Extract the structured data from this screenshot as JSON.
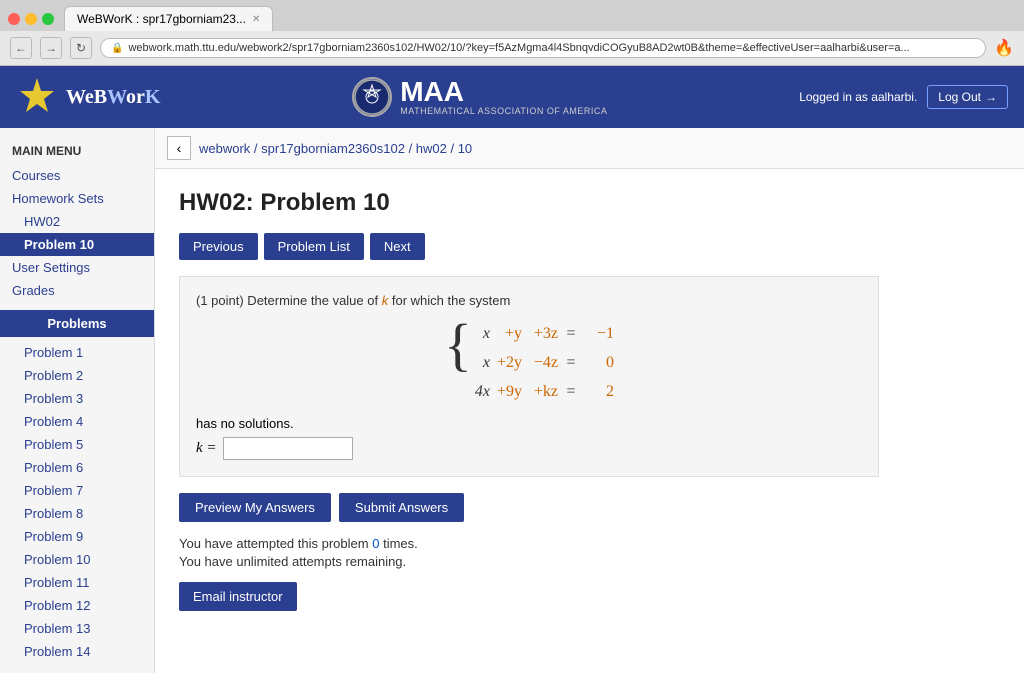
{
  "browser": {
    "tab_title": "WeBWorK : spr17gborniam23...",
    "url": "webwork.math.ttu.edu/webwork2/spr17gborniam2360s102/HW02/10/?key=f5AzMgma4l4SbnqvdiCOGyuB8AD2wt0B&theme=&effectiveUser=aalharbi&user=a...",
    "back_label": "←",
    "forward_label": "→",
    "refresh_label": "↻"
  },
  "header": {
    "logo_text": "WeBWorK",
    "maa_big": "MAA",
    "maa_sub": "MATHEMATICAL ASSOCIATION OF AMERICA",
    "logged_in_label": "Logged in as",
    "logged_in_user": "aalharbi.",
    "logout_label": "Log Out"
  },
  "sidebar": {
    "main_menu_title": "MAIN MENU",
    "links": [
      {
        "label": "Courses",
        "id": "courses",
        "indented": false,
        "active": false
      },
      {
        "label": "Homework Sets",
        "id": "homework-sets",
        "indented": false,
        "active": false
      },
      {
        "label": "HW02",
        "id": "hw02",
        "indented": true,
        "active": false
      },
      {
        "label": "Problem 10",
        "id": "problem-10",
        "indented": true,
        "active": true
      },
      {
        "label": "User Settings",
        "id": "user-settings",
        "indented": false,
        "active": false
      },
      {
        "label": "Grades",
        "id": "grades",
        "indented": false,
        "active": false
      }
    ],
    "problems_section_title": "Problems",
    "problems": [
      "Problem 1",
      "Problem 2",
      "Problem 3",
      "Problem 4",
      "Problem 5",
      "Problem 6",
      "Problem 7",
      "Problem 8",
      "Problem 9",
      "Problem 10",
      "Problem 11",
      "Problem 12",
      "Problem 13",
      "Problem 14"
    ]
  },
  "breadcrumb": {
    "back_label": "‹",
    "path": "webwork / spr17gborniam2360s102 / hw02 / 10"
  },
  "problem": {
    "title": "HW02: Problem 10",
    "btn_previous": "Previous",
    "btn_problem_list": "Problem List",
    "btn_next": "Next",
    "statement_prefix": "(1 point) Determine the value of",
    "k_var": "k",
    "statement_suffix": "for which the system",
    "matrix": {
      "rows": [
        {
          "lhs": [
            "x",
            "+y",
            "+3z"
          ],
          "eq": "=",
          "rhs": "-1"
        },
        {
          "lhs": [
            "x",
            "+2y",
            "-4z"
          ],
          "eq": "=",
          "rhs": "0"
        },
        {
          "lhs": [
            "4x",
            "+9y",
            "+kz"
          ],
          "eq": "=",
          "rhs": "2"
        }
      ]
    },
    "has_no_solutions": "has no solutions.",
    "k_label": "k =",
    "k_placeholder": "",
    "btn_preview": "Preview My Answers",
    "btn_submit": "Submit Answers",
    "attempt_text1": "You have attempted this problem",
    "attempt_count": "0",
    "attempt_text2": "times.",
    "unlimited_text": "You have unlimited attempts remaining.",
    "email_btn": "Email instructor"
  },
  "colors": {
    "primary": "#2a3f8f",
    "accent": "#cc6600",
    "link": "#2a3f8f"
  }
}
